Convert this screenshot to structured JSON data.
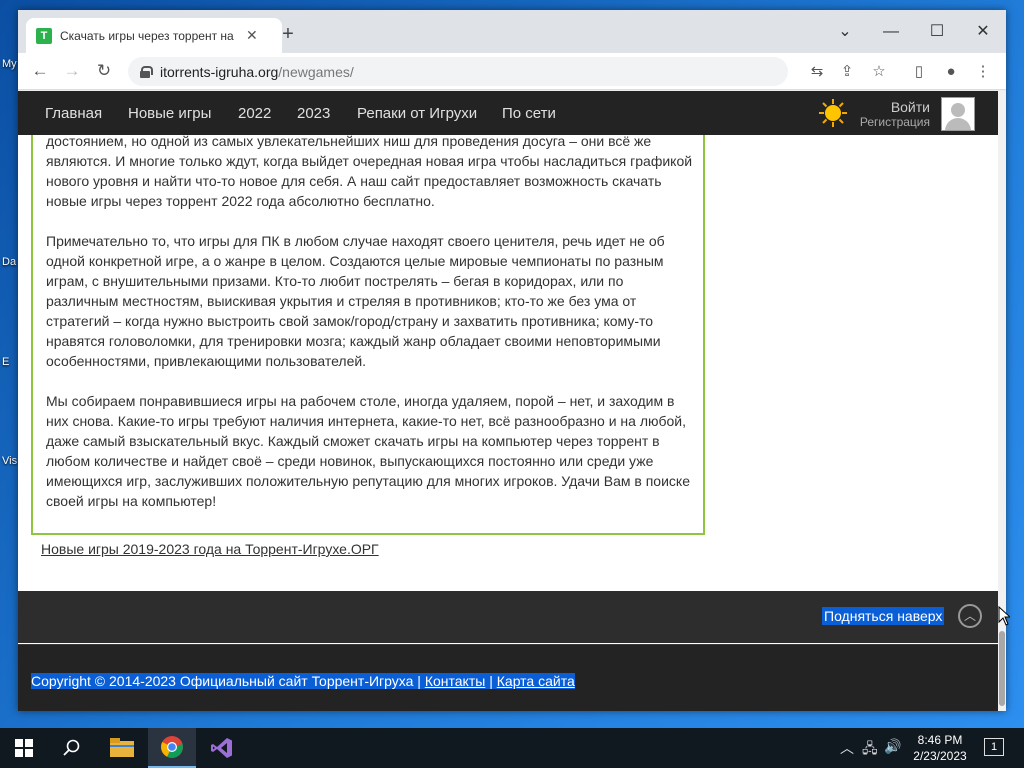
{
  "desktop": {
    "icons": [
      "My",
      "Da",
      "E",
      "Vis"
    ]
  },
  "browser": {
    "tab_title": "Скачать игры через торрент на",
    "favicon_text": "T",
    "url_host": "itorrents-igruha.org",
    "url_path": "/newgames/"
  },
  "site": {
    "nav": [
      "Главная",
      "Новые игры",
      "2022",
      "2023",
      "Репаки от Игрухи",
      "По сети"
    ],
    "login": "Войти",
    "register": "Регистрация",
    "paragraphs": [
      "достоянием, но одной из самых увлекательнейших ниш для проведения досуга – они всё же являются. И многие только ждут, когда выйдет очередная новая игра чтобы насладиться графикой нового уровня и найти что-то новое для себя. А наш сайт предоставляет возможность скачать новые игры через торрент 2022 года абсолютно бесплатно.",
      "Примечательно то, что игры для ПК в любом случае находят своего ценителя, речь идет не об одной конкретной игре, а о жанре в целом. Создаются целые мировые чемпионаты по разным играм, с внушительными призами. Кто-то любит пострелять – бегая в коридорах, или по различным местностям, выискивая укрытия и стреляя в противников; кто-то же без ума от стратегий – когда нужно выстроить свой замок/город/страну и захватить противника; кому-то нравятся головоломки, для тренировки мозга; каждый жанр обладает своими неповторимыми особенностями, привлекающими пользователей.",
      "Мы собираем понравившиеся игры на рабочем столе, иногда удаляем, порой – нет, и заходим в них снова. Какие-то игры требуют наличия интернета, какие-то нет, всё разнообразно и на любой, даже самый взыскательный вкус. Каждый сможет скачать игры на компьютер через торрент в любом количестве и найдет своё – среди новинок, выпускающихся постоянно или среди уже имеющихся игр, заслуживших положительную репутацию для многих игроков. Удачи Вам в поиске своей игры на компьютер!"
    ],
    "bottom_link": "Новые игры 2019-2023 года на Торрент-Игрухе.ОРГ",
    "back_to_top": "Подняться наверх",
    "copyright": "Copyright © 2014-2023 Официальный сайт Торрент-Игруха |",
    "contacts": "Контакты",
    "separator": "|",
    "sitemap": "Карта сайта"
  },
  "taskbar": {
    "time": "8:46 PM",
    "date": "2/23/2023",
    "notifications": "1"
  },
  "colors": {
    "content_border": "#8ec63f",
    "selection": "#0b5fd6",
    "nav_bg": "#232323"
  }
}
